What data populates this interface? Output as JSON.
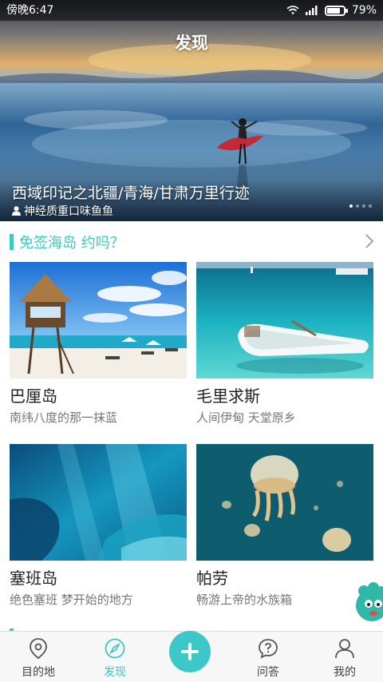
{
  "status_bar": {
    "time": "傍晚6:47",
    "battery": "79%",
    "battery_level": 0.79,
    "icons": [
      "wifi-icon",
      "signal-icon",
      "battery-icon"
    ]
  },
  "hero": {
    "title": "发现",
    "caption": "西域印记之北疆/青海/甘肃万里行迹",
    "author": "神经质重口味鱼鱼",
    "slides_total": 4,
    "slide_active": 1
  },
  "section": {
    "title": "免签海岛 约吗？",
    "cards": [
      {
        "name": "巴厘岛",
        "desc": "南纬八度的那一抹蓝"
      },
      {
        "name": "毛里求斯",
        "desc": "人间伊甸 天堂原乡"
      },
      {
        "name": "塞班岛",
        "desc": "绝色塞班 梦开始的地方"
      },
      {
        "name": "帕劳",
        "desc": "畅游上帝的水族箱"
      }
    ]
  },
  "tabbar": {
    "tabs": [
      {
        "label": "目的地",
        "icon": "map-pin-icon"
      },
      {
        "label": "发现",
        "icon": "compass-icon"
      },
      {
        "label": "",
        "icon": "plus-icon"
      },
      {
        "label": "问答",
        "icon": "question-bubble-icon"
      },
      {
        "label": "我的",
        "icon": "user-icon"
      }
    ]
  },
  "colors": {
    "accent": "#3cc7c8",
    "text": "#222222",
    "subtext": "#777777"
  }
}
